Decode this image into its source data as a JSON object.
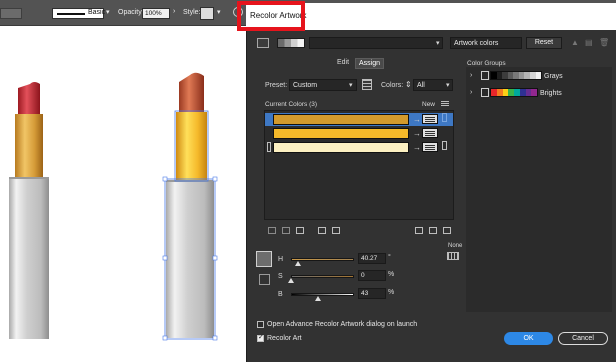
{
  "control_bar": {
    "stroke_style": "Basic",
    "opacity_label": "Opacity:",
    "opacity_value": "100%",
    "style_label": "Style:"
  },
  "dialog": {
    "title": "Recolor Artwork",
    "color_set_name": "Artwork colors",
    "reset_label": "Reset",
    "tabs": {
      "edit": "Edit",
      "assign": "Assign"
    },
    "preset_label": "Preset:",
    "preset_value": "Custom",
    "colors_label": "Colors:",
    "colors_value": "All",
    "current_colors_label": "Current Colors (3)",
    "new_label": "New",
    "color_rows": [
      {
        "current": "#d39a2c",
        "target": "#d39a2c"
      },
      {
        "current": "#f5b92a",
        "target": "#f5b92a"
      },
      {
        "current": "#fdf1c2",
        "target": "#fdf1c2"
      }
    ],
    "sliders": [
      {
        "letter": "H",
        "value": "40.27",
        "unit": "°",
        "knob_fraction": 0.11
      },
      {
        "letter": "S",
        "value": "0",
        "unit": "%",
        "knob_fraction": 0.0
      },
      {
        "letter": "B",
        "value": "43",
        "unit": "%",
        "knob_fraction": 0.43
      }
    ],
    "none_label": "None",
    "color_groups_label": "Color Groups",
    "color_groups": [
      {
        "name": "Grays",
        "swatches": [
          "#000000",
          "#1e1e1e",
          "#3c3c3c",
          "#5a5a5a",
          "#787878",
          "#969696",
          "#b4b4b4",
          "#d2d2d2",
          "#f0f0f0"
        ]
      },
      {
        "name": "Brights",
        "swatches": [
          "#e8262a",
          "#f47b20",
          "#fcd116",
          "#39b54a",
          "#00a99d",
          "#2e3192",
          "#662d91",
          "#92278f"
        ]
      }
    ],
    "open_advanced_label": "Open Advance Recolor Artwork dialog on launch",
    "open_advanced_checked": false,
    "recolor_art_label": "Recolor Art",
    "recolor_art_checked": true,
    "ok_label": "OK",
    "cancel_label": "Cancel"
  },
  "colors": {
    "highlight_frame": "#e6141c",
    "accent_button": "#2d88e6",
    "dialog_bg": "#323232"
  }
}
